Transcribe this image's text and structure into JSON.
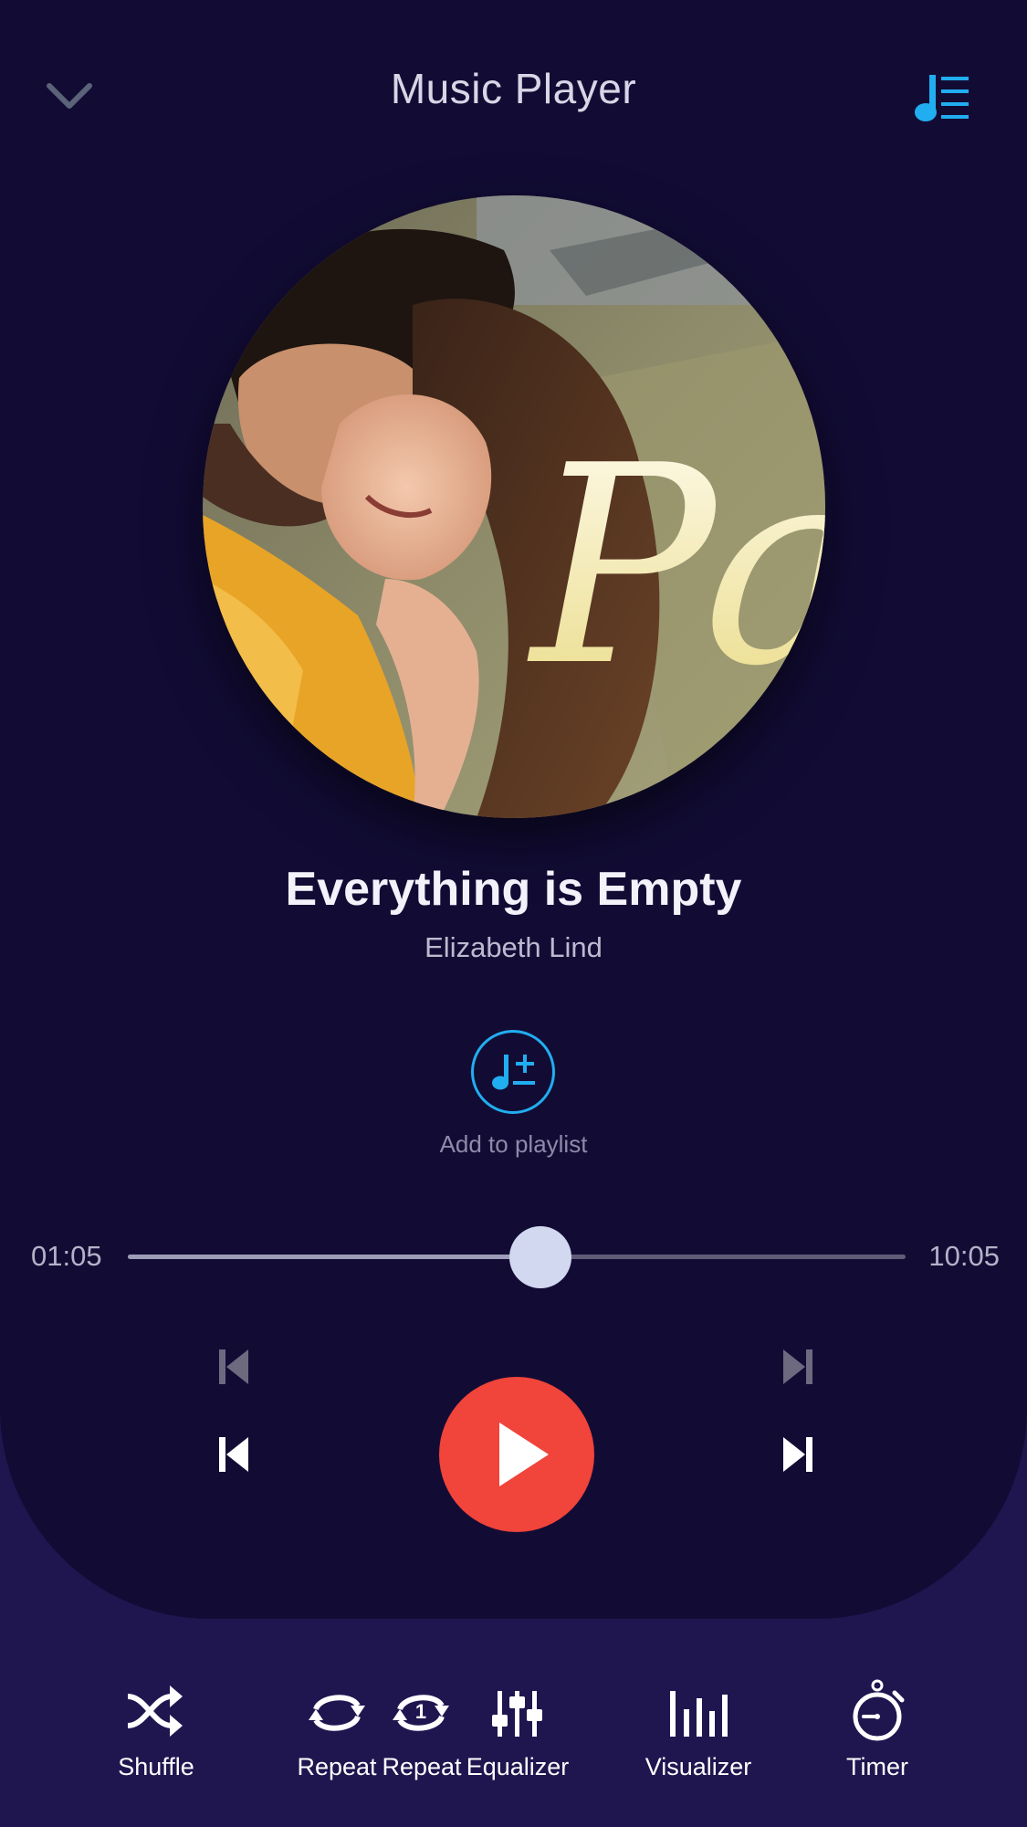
{
  "header": {
    "title": "Music Player"
  },
  "song": {
    "title": "Everything is Empty",
    "artist": "Elizabeth Lind",
    "album_art_text": "Pal"
  },
  "playlist": {
    "add_label": "Add to playlist"
  },
  "progress": {
    "current_time": "01:05",
    "total_time": "10:05",
    "fraction": 0.5
  },
  "controls": {
    "state": "paused",
    "play_color": "#f1443a"
  },
  "bottom_bar": {
    "shuffle": "Shuffle",
    "repeat": "Repeat",
    "repeat_one": "Repeat",
    "repeat_one_badge": "1",
    "equalizer": "Equalizer",
    "visualizer": "Visualizer",
    "timer": "Timer"
  },
  "colors": {
    "accent": "#21aef0",
    "background_top": "#120c35",
    "background_bottom": "#1f1650"
  },
  "icons": [
    "chevron-down-icon",
    "playlist-music-icon",
    "music-plus-minus-icon",
    "skip-previous-icon",
    "skip-next-icon",
    "play-icon",
    "shuffle-icon",
    "repeat-icon",
    "repeat-one-icon",
    "equalizer-icon",
    "visualizer-icon",
    "timer-icon"
  ]
}
